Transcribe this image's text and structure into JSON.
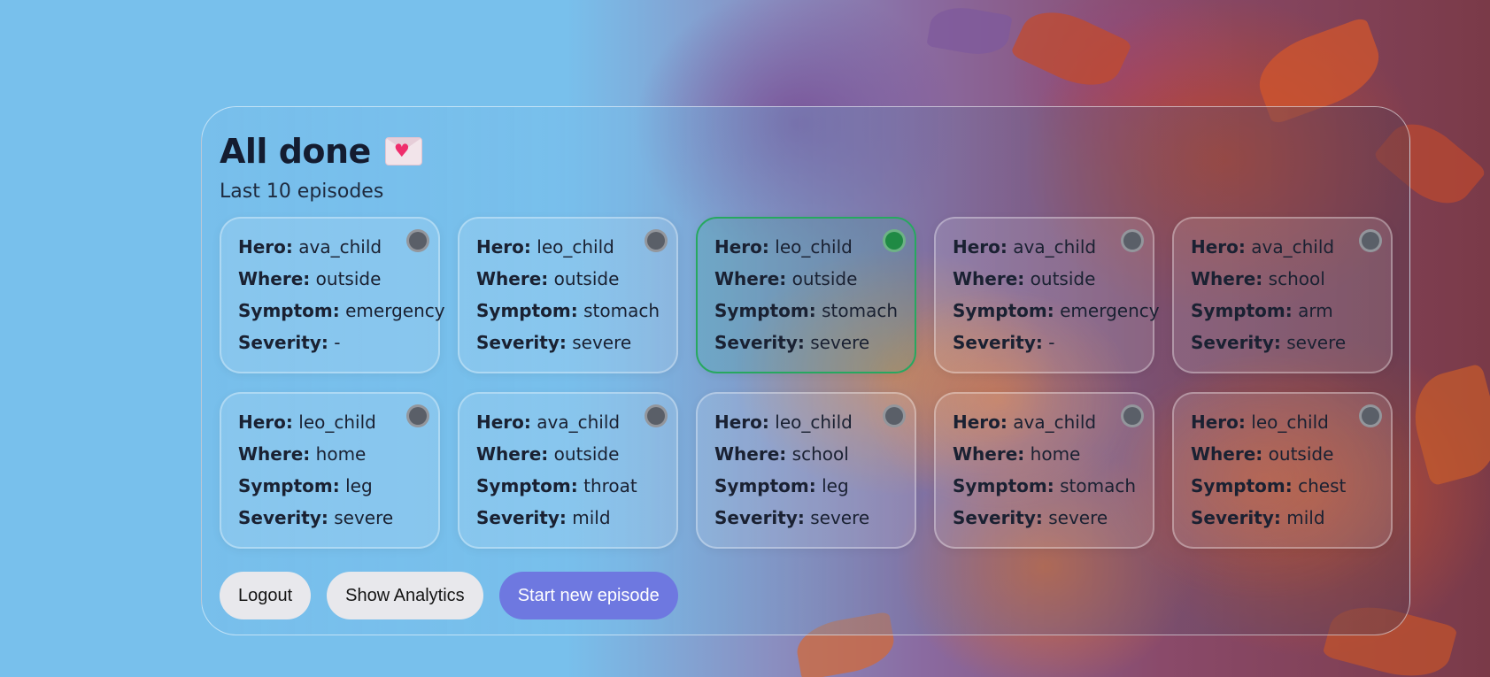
{
  "header": {
    "title": "All done",
    "title_icon": "envelope-heart-icon"
  },
  "subtitle": "Last 10 episodes",
  "labels": {
    "hero": "Hero:",
    "where": "Where:",
    "symptom": "Symptom:",
    "severity": "Severity:"
  },
  "episodes": [
    {
      "hero": "ava_child",
      "where": "outside",
      "symptom": "emergency",
      "severity": "-",
      "selected": false
    },
    {
      "hero": "leo_child",
      "where": "outside",
      "symptom": "stomach",
      "severity": "severe",
      "selected": false
    },
    {
      "hero": "leo_child",
      "where": "outside",
      "symptom": "stomach",
      "severity": "severe",
      "selected": true
    },
    {
      "hero": "ava_child",
      "where": "outside",
      "symptom": "emergency",
      "severity": "-",
      "selected": false
    },
    {
      "hero": "ava_child",
      "where": "school",
      "symptom": "arm",
      "severity": "severe",
      "selected": false
    },
    {
      "hero": "leo_child",
      "where": "home",
      "symptom": "leg",
      "severity": "severe",
      "selected": false
    },
    {
      "hero": "ava_child",
      "where": "outside",
      "symptom": "throat",
      "severity": "mild",
      "selected": false
    },
    {
      "hero": "leo_child",
      "where": "school",
      "symptom": "leg",
      "severity": "severe",
      "selected": false
    },
    {
      "hero": "ava_child",
      "where": "home",
      "symptom": "stomach",
      "severity": "severe",
      "selected": false
    },
    {
      "hero": "leo_child",
      "where": "outside",
      "symptom": "chest",
      "severity": "mild",
      "selected": false
    }
  ],
  "buttons": {
    "logout": "Logout",
    "analytics": "Show Analytics",
    "new_episode": "Start new episode"
  },
  "colors": {
    "selected_border": "#27a860",
    "selected_dot": "#1f8a44",
    "primary_button": "#6e78e0"
  }
}
